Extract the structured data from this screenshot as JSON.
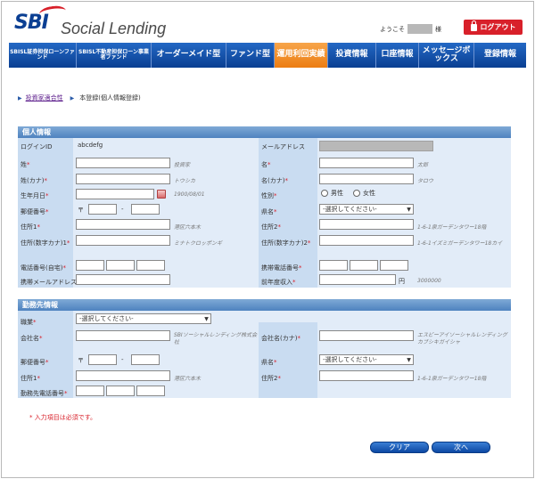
{
  "header": {
    "brand": "Social Lending",
    "welcome_prefix": "ようこそ",
    "welcome_suffix": "様",
    "logout_label": "ログアウト"
  },
  "nav": {
    "items": [
      {
        "label": "SBISL証券担保ローンファンド"
      },
      {
        "label": "SBISL不動産担保ローン事業者ファンド"
      },
      {
        "label": "オーダーメイド型"
      },
      {
        "label": "ファンド型"
      },
      {
        "label": "運用利回実績"
      },
      {
        "label": "投資情報"
      },
      {
        "label": "口座情報"
      },
      {
        "label": "メッセージボックス"
      },
      {
        "label": "登録情報"
      }
    ]
  },
  "breadcrumb": {
    "link": "投資家適合性",
    "current": "本登録(個人情報登録)"
  },
  "personal": {
    "title": "個人情報",
    "login_id_label": "ログインID",
    "login_id_value": "abcdefg",
    "email_label": "メールアドレス",
    "last_name_label": "姓",
    "last_name_hint": "投資家",
    "first_name_label": "名",
    "first_name_hint": "太郎",
    "last_kana_label": "姓(カナ)",
    "last_kana_hint": "トウシカ",
    "first_kana_label": "名(カナ)",
    "first_kana_hint": "タロウ",
    "birth_label": "生年月日",
    "birth_hint": "1900/08/01",
    "gender_label": "性別",
    "gender_male": "男性",
    "gender_female": "女性",
    "zip_label": "郵便番号",
    "zip_mark": "〒",
    "zip_dash": "-",
    "pref_label": "県名",
    "pref_select": "-選択してください-",
    "addr1_label": "住所1",
    "addr1_hint": "港区六本木",
    "addr2_label": "住所2",
    "addr2_hint": "1-6-1泉ガーデンタワー18階",
    "addr_kana1_label": "住所(数字カナ)1",
    "addr_kana1_hint": "ミナトクロッポンギ",
    "addr_kana2_label": "住所(数字カナ)2",
    "addr_kana2_hint": "1-6-1イズミガーデンタワー18カイ",
    "phone_label": "電話番号(自宅)",
    "mobile_label": "携帯電話番号",
    "mobile_email_label": "携帯メールアドレス",
    "income_label": "前年度収入",
    "income_unit": "円",
    "income_hint": "3000000"
  },
  "work": {
    "title": "勤務先情報",
    "job_label": "職業",
    "job_select": "-選択してください-",
    "company_label": "会社名",
    "company_hint": "SBIソーシャルレンディング株式会社",
    "company_kana_label": "会社名(カナ)",
    "company_kana_hint": "エスビーアイソーシャルレンディングカブシキガイシャ",
    "zip_label": "郵便番号",
    "zip_mark": "〒",
    "zip_dash": "-",
    "pref_label": "県名",
    "pref_select": "-選択してください-",
    "addr1_label": "住所1",
    "addr1_hint": "港区六本木",
    "addr2_label": "住所2",
    "addr2_hint": "1-6-1泉ガーデンタワー18階",
    "phone_label": "勤務先電話番号"
  },
  "required_note": "* 入力項目は必須です。",
  "req_mark": "*",
  "buttons": {
    "clear": "クリア",
    "next": "次へ"
  }
}
